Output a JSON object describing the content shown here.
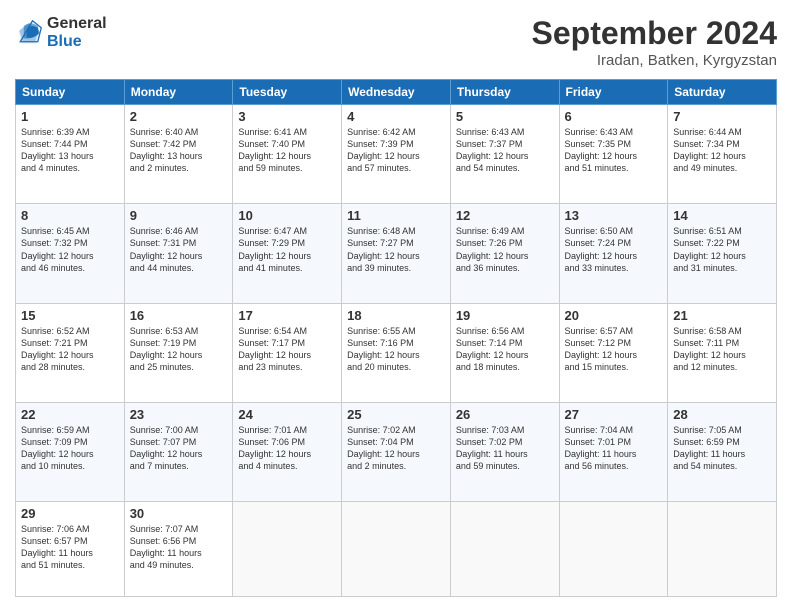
{
  "header": {
    "logo_general": "General",
    "logo_blue": "Blue",
    "title": "September 2024",
    "location": "Iradan, Batken, Kyrgyzstan"
  },
  "days_of_week": [
    "Sunday",
    "Monday",
    "Tuesday",
    "Wednesday",
    "Thursday",
    "Friday",
    "Saturday"
  ],
  "weeks": [
    [
      {
        "day": "1",
        "text": "Sunrise: 6:39 AM\nSunset: 7:44 PM\nDaylight: 13 hours\nand 4 minutes."
      },
      {
        "day": "2",
        "text": "Sunrise: 6:40 AM\nSunset: 7:42 PM\nDaylight: 13 hours\nand 2 minutes."
      },
      {
        "day": "3",
        "text": "Sunrise: 6:41 AM\nSunset: 7:40 PM\nDaylight: 12 hours\nand 59 minutes."
      },
      {
        "day": "4",
        "text": "Sunrise: 6:42 AM\nSunset: 7:39 PM\nDaylight: 12 hours\nand 57 minutes."
      },
      {
        "day": "5",
        "text": "Sunrise: 6:43 AM\nSunset: 7:37 PM\nDaylight: 12 hours\nand 54 minutes."
      },
      {
        "day": "6",
        "text": "Sunrise: 6:43 AM\nSunset: 7:35 PM\nDaylight: 12 hours\nand 51 minutes."
      },
      {
        "day": "7",
        "text": "Sunrise: 6:44 AM\nSunset: 7:34 PM\nDaylight: 12 hours\nand 49 minutes."
      }
    ],
    [
      {
        "day": "8",
        "text": "Sunrise: 6:45 AM\nSunset: 7:32 PM\nDaylight: 12 hours\nand 46 minutes."
      },
      {
        "day": "9",
        "text": "Sunrise: 6:46 AM\nSunset: 7:31 PM\nDaylight: 12 hours\nand 44 minutes."
      },
      {
        "day": "10",
        "text": "Sunrise: 6:47 AM\nSunset: 7:29 PM\nDaylight: 12 hours\nand 41 minutes."
      },
      {
        "day": "11",
        "text": "Sunrise: 6:48 AM\nSunset: 7:27 PM\nDaylight: 12 hours\nand 39 minutes."
      },
      {
        "day": "12",
        "text": "Sunrise: 6:49 AM\nSunset: 7:26 PM\nDaylight: 12 hours\nand 36 minutes."
      },
      {
        "day": "13",
        "text": "Sunrise: 6:50 AM\nSunset: 7:24 PM\nDaylight: 12 hours\nand 33 minutes."
      },
      {
        "day": "14",
        "text": "Sunrise: 6:51 AM\nSunset: 7:22 PM\nDaylight: 12 hours\nand 31 minutes."
      }
    ],
    [
      {
        "day": "15",
        "text": "Sunrise: 6:52 AM\nSunset: 7:21 PM\nDaylight: 12 hours\nand 28 minutes."
      },
      {
        "day": "16",
        "text": "Sunrise: 6:53 AM\nSunset: 7:19 PM\nDaylight: 12 hours\nand 25 minutes."
      },
      {
        "day": "17",
        "text": "Sunrise: 6:54 AM\nSunset: 7:17 PM\nDaylight: 12 hours\nand 23 minutes."
      },
      {
        "day": "18",
        "text": "Sunrise: 6:55 AM\nSunset: 7:16 PM\nDaylight: 12 hours\nand 20 minutes."
      },
      {
        "day": "19",
        "text": "Sunrise: 6:56 AM\nSunset: 7:14 PM\nDaylight: 12 hours\nand 18 minutes."
      },
      {
        "day": "20",
        "text": "Sunrise: 6:57 AM\nSunset: 7:12 PM\nDaylight: 12 hours\nand 15 minutes."
      },
      {
        "day": "21",
        "text": "Sunrise: 6:58 AM\nSunset: 7:11 PM\nDaylight: 12 hours\nand 12 minutes."
      }
    ],
    [
      {
        "day": "22",
        "text": "Sunrise: 6:59 AM\nSunset: 7:09 PM\nDaylight: 12 hours\nand 10 minutes."
      },
      {
        "day": "23",
        "text": "Sunrise: 7:00 AM\nSunset: 7:07 PM\nDaylight: 12 hours\nand 7 minutes."
      },
      {
        "day": "24",
        "text": "Sunrise: 7:01 AM\nSunset: 7:06 PM\nDaylight: 12 hours\nand 4 minutes."
      },
      {
        "day": "25",
        "text": "Sunrise: 7:02 AM\nSunset: 7:04 PM\nDaylight: 12 hours\nand 2 minutes."
      },
      {
        "day": "26",
        "text": "Sunrise: 7:03 AM\nSunset: 7:02 PM\nDaylight: 11 hours\nand 59 minutes."
      },
      {
        "day": "27",
        "text": "Sunrise: 7:04 AM\nSunset: 7:01 PM\nDaylight: 11 hours\nand 56 minutes."
      },
      {
        "day": "28",
        "text": "Sunrise: 7:05 AM\nSunset: 6:59 PM\nDaylight: 11 hours\nand 54 minutes."
      }
    ],
    [
      {
        "day": "29",
        "text": "Sunrise: 7:06 AM\nSunset: 6:57 PM\nDaylight: 11 hours\nand 51 minutes."
      },
      {
        "day": "30",
        "text": "Sunrise: 7:07 AM\nSunset: 6:56 PM\nDaylight: 11 hours\nand 49 minutes."
      },
      {
        "day": "",
        "text": ""
      },
      {
        "day": "",
        "text": ""
      },
      {
        "day": "",
        "text": ""
      },
      {
        "day": "",
        "text": ""
      },
      {
        "day": "",
        "text": ""
      }
    ]
  ]
}
